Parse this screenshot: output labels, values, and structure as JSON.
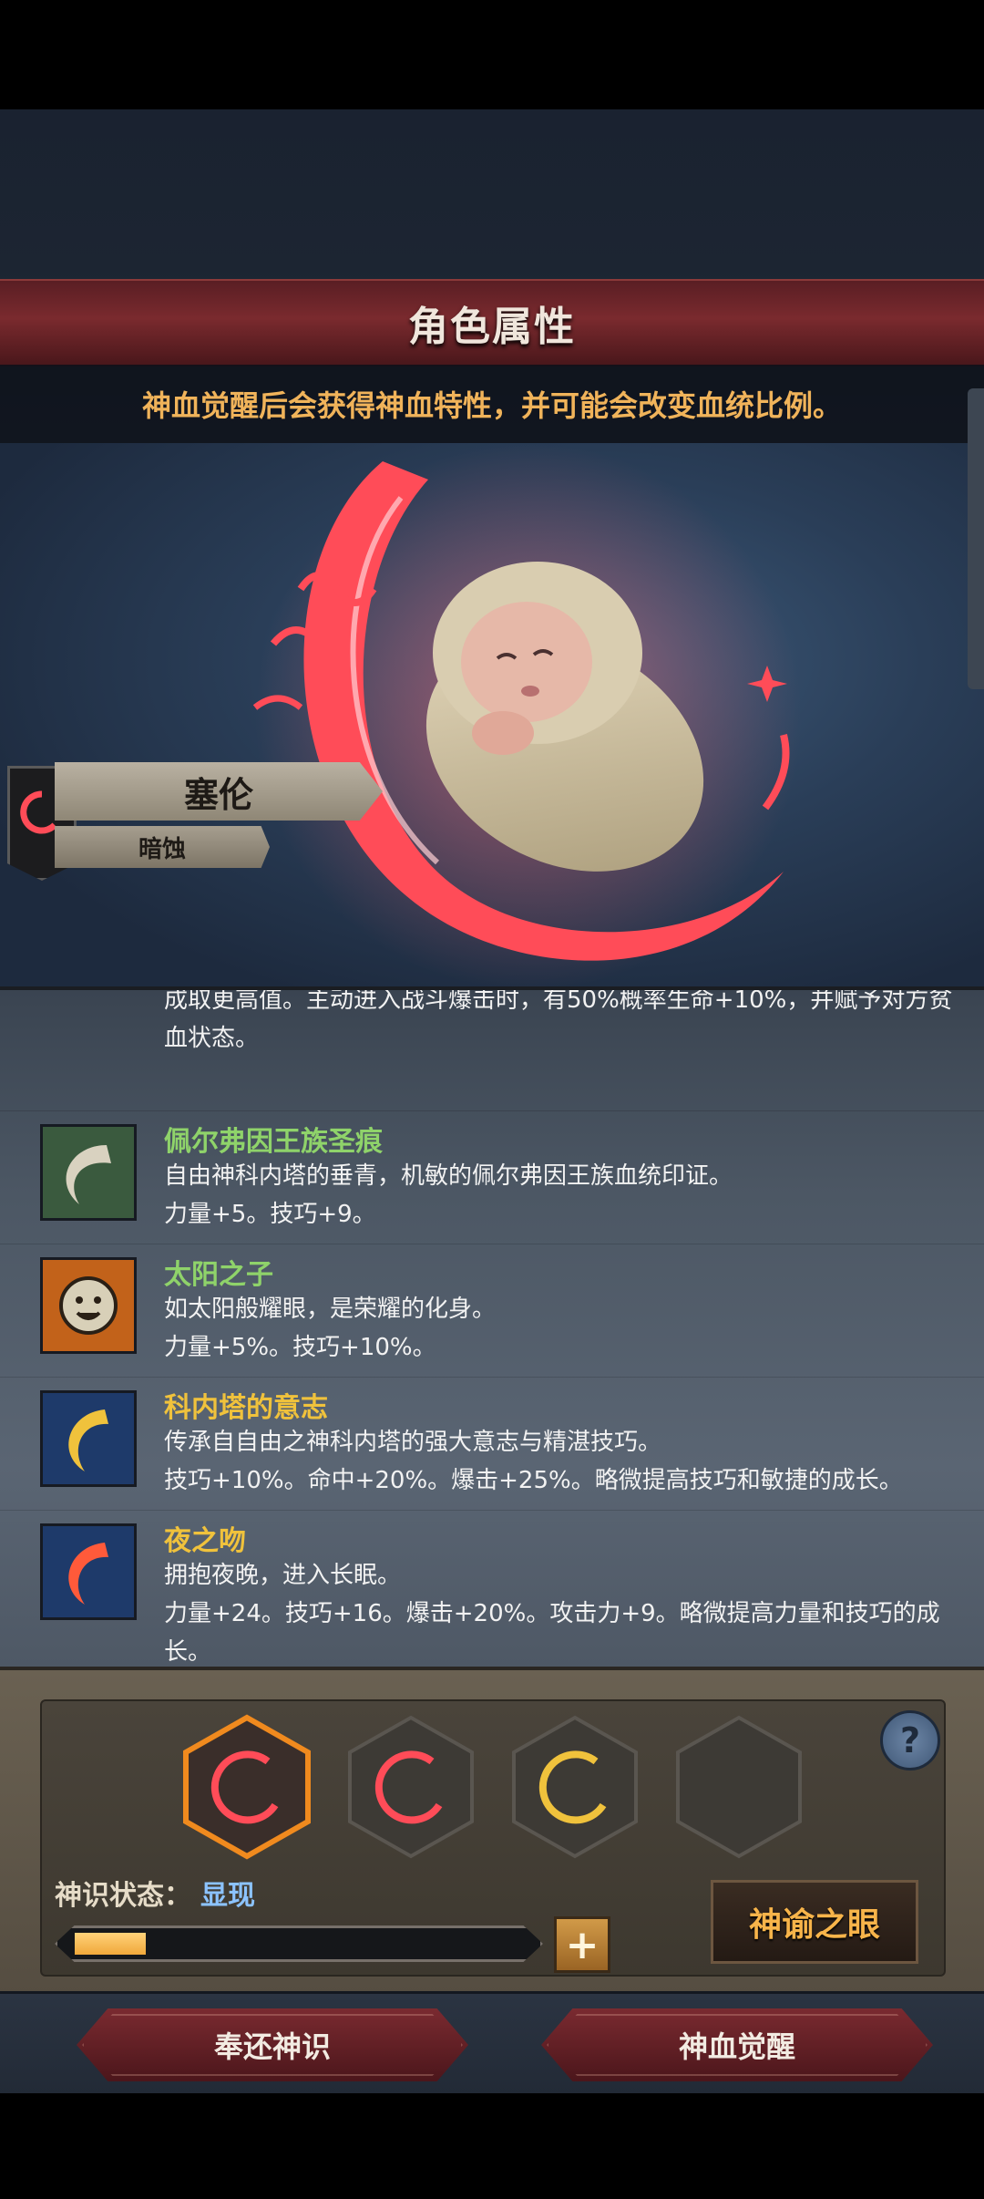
{
  "header": {
    "title": "角色属性",
    "subtitle": "神血觉醒后会获得神血特性，并可能会改变血统比例。"
  },
  "character": {
    "name": "塞伦",
    "tag": "暗蚀"
  },
  "traits_partial_text": "成取更高值。主动进入战斗爆击时，有50%概率生命+10%，并赋予对方贫血状态。",
  "traits": [
    {
      "name": "佩尔弗因王族圣痕",
      "name_color": "#8fd36a",
      "icon": "pale-wave-icon",
      "desc": "自由神科内塔的垂青，机敏的佩尔弗因王族血统印证。",
      "stats": "力量+5。技巧+9。"
    },
    {
      "name": "太阳之子",
      "name_color": "#8fd36a",
      "icon": "sun-face-icon",
      "desc": "如太阳般耀眼，是荣耀的化身。",
      "stats": "力量+5%。技巧+10%。"
    },
    {
      "name": "科内塔的意志",
      "name_color": "#f0c23c",
      "icon": "golden-moon-icon",
      "desc": "传承自自由之神科内塔的强大意志与精湛技巧。",
      "stats": "技巧+10%。命中+20%。爆击+25%。略微提高技巧和敏捷的成长。"
    },
    {
      "name": "夜之吻",
      "name_color": "#f0c23c",
      "icon": "crimson-moon-icon",
      "desc": "拥抱夜晚，进入长眠。",
      "stats": "力量+24。技巧+16。爆击+20%。攻击力+9。略微提高力量和技巧的成长。"
    }
  ],
  "sense": {
    "label": "神识状态：",
    "value": "显现",
    "progress": 0.16
  },
  "buttons": {
    "oracle": "神谕之眼",
    "return": "奉还神识",
    "awaken": "神血觉醒",
    "help": "?",
    "plus": "+"
  },
  "colors": {
    "accent": "#f0b35a",
    "crimson": "#ff4c58",
    "gold": "#f0c23c"
  }
}
